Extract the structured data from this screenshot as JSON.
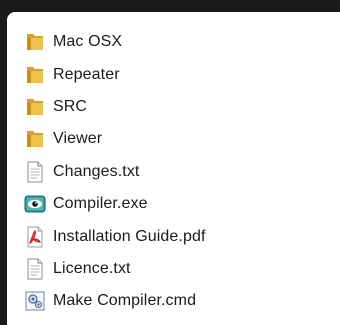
{
  "file_list": {
    "items": [
      {
        "label": "Mac OSX",
        "icon": "folder-icon"
      },
      {
        "label": "Repeater",
        "icon": "folder-icon"
      },
      {
        "label": "SRC",
        "icon": "folder-icon"
      },
      {
        "label": "Viewer",
        "icon": "folder-icon"
      },
      {
        "label": "Changes.txt",
        "icon": "text-file-icon"
      },
      {
        "label": "Compiler.exe",
        "icon": "exe-eye-icon"
      },
      {
        "label": "Installation Guide.pdf",
        "icon": "pdf-file-icon"
      },
      {
        "label": "Licence.txt",
        "icon": "text-file-icon"
      },
      {
        "label": "Make Compiler.cmd",
        "icon": "cmd-script-icon"
      }
    ]
  },
  "colors": {
    "folder": "#e8b83a",
    "pdf_red": "#d42121",
    "exe_teal": "#3aa6a8",
    "window_bg": "#ffffff",
    "desktop_bg": "#1a1a1a"
  }
}
